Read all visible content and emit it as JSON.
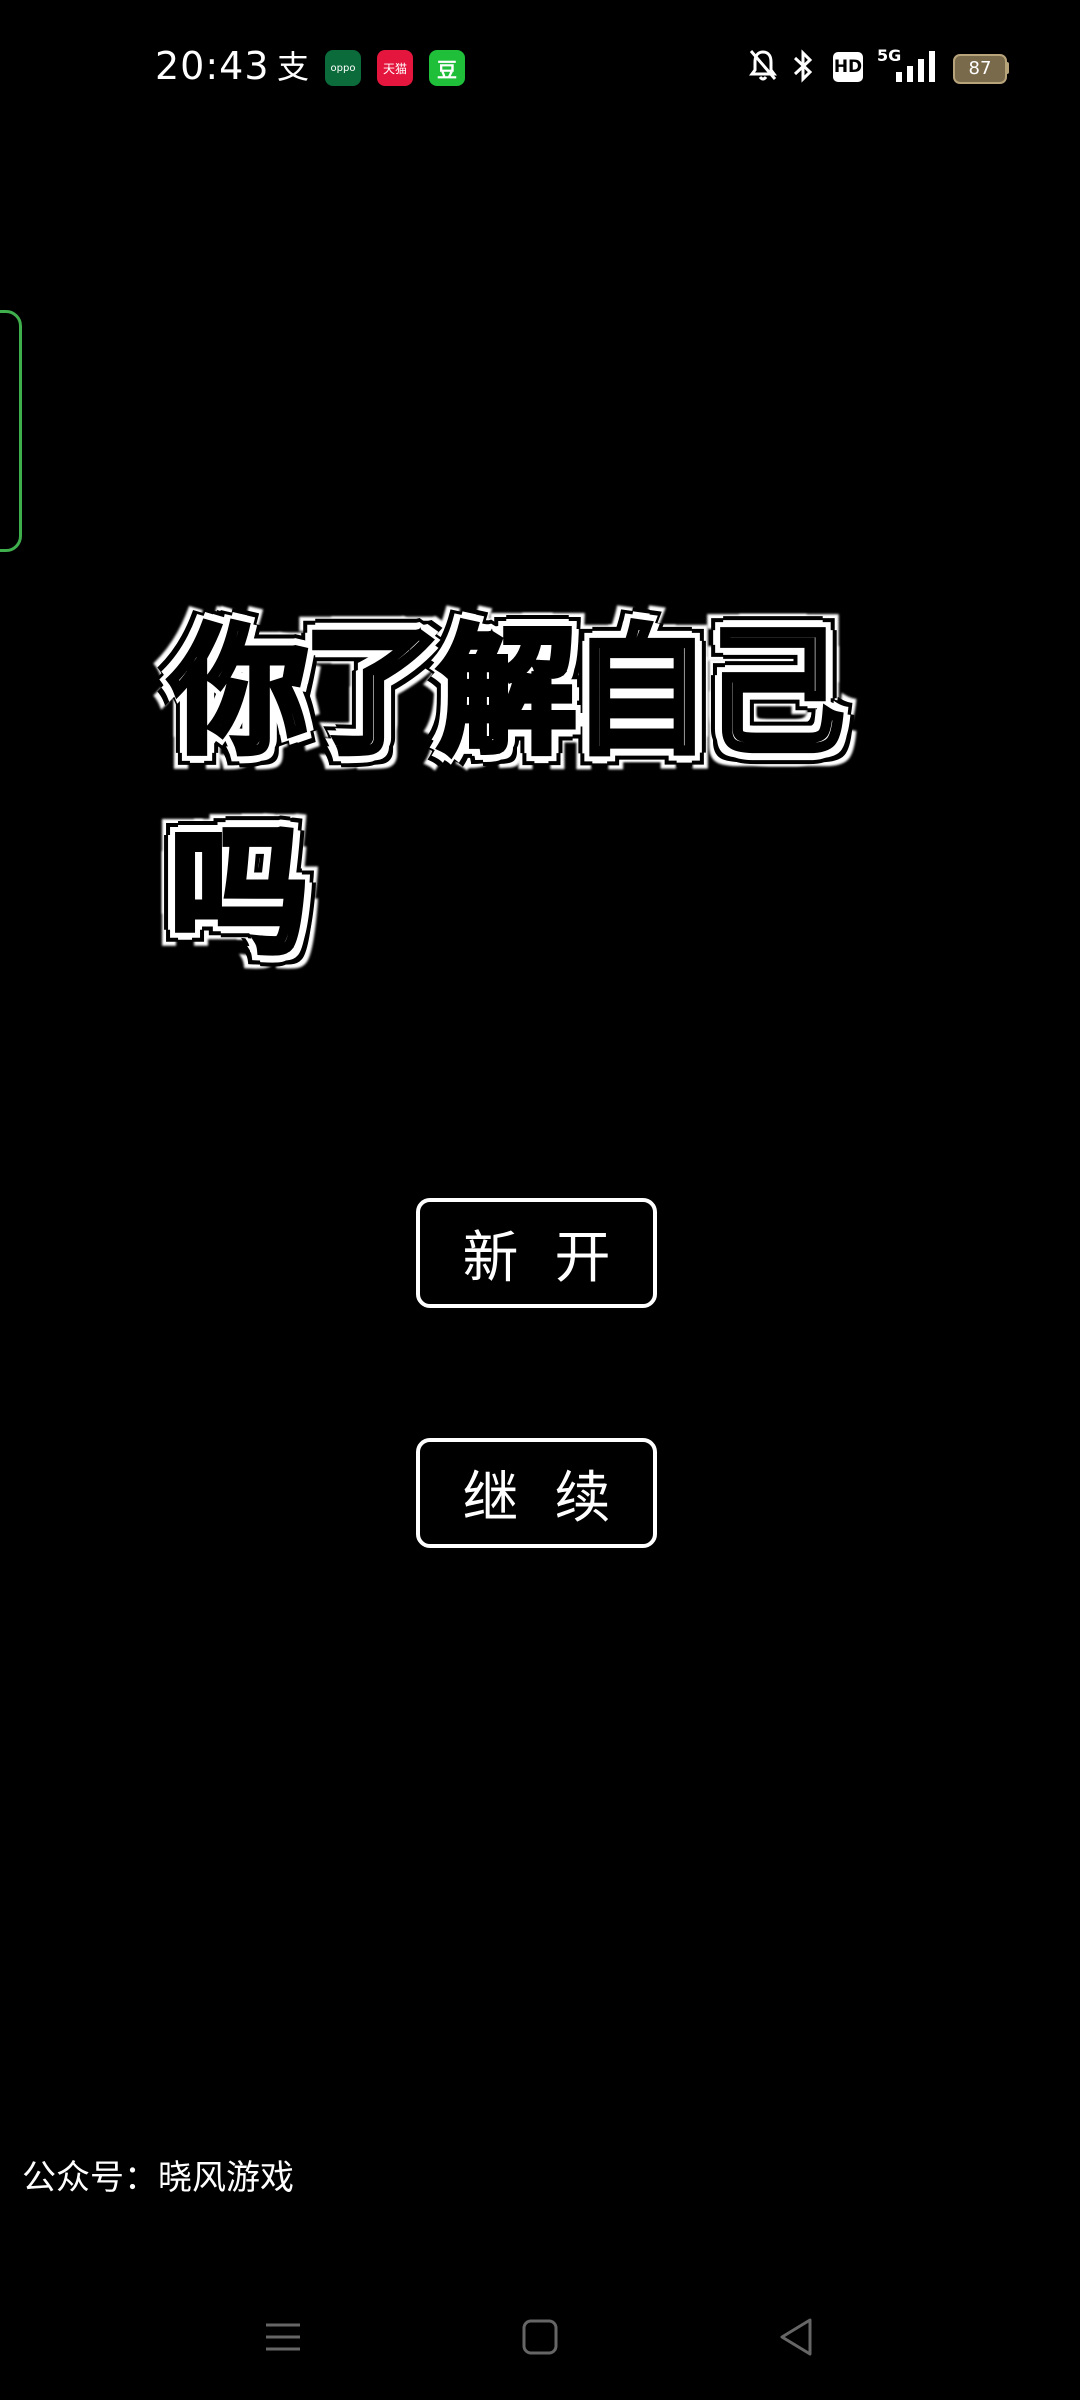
{
  "status_bar": {
    "time": "20:43",
    "app_icons": {
      "alipay": "支",
      "oppo": "oppo",
      "tmall": "天猫",
      "douban": "豆"
    },
    "hd_label": "HD",
    "network_label": "5G",
    "battery_level": "87"
  },
  "game": {
    "title": "你了解自己吗",
    "new_game_label": "新开",
    "continue_label": "继续"
  },
  "footer": {
    "text": "公众号：晓风游戏"
  },
  "colors": {
    "background": "#000000",
    "side_tab_border": "#3fae4c",
    "button_border": "#ffffff"
  }
}
